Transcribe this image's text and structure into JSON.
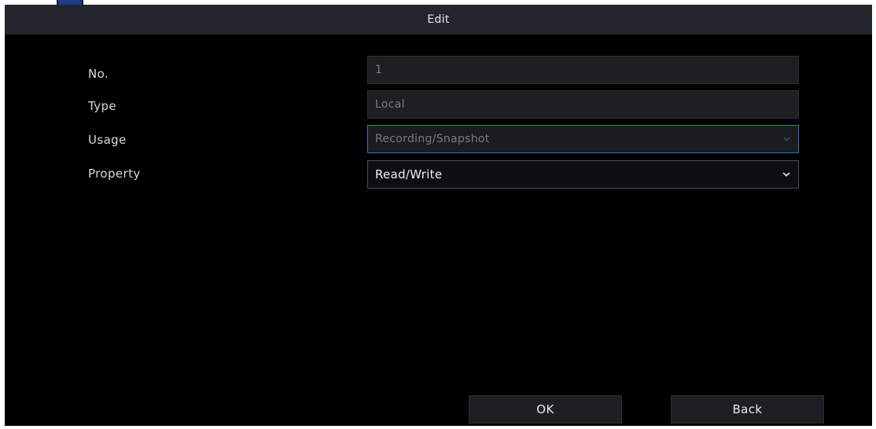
{
  "dialog": {
    "title": "Edit"
  },
  "form": {
    "no": {
      "label": "No.",
      "value": "1"
    },
    "type": {
      "label": "Type",
      "value": "Local"
    },
    "usage": {
      "label": "Usage",
      "value": "Recording/Snapshot"
    },
    "property": {
      "label": "Property",
      "value": "Read/Write"
    }
  },
  "buttons": {
    "ok": "OK",
    "back": "Back"
  },
  "colors": {
    "background": "#000000",
    "titlebar": "#23262c",
    "focus_border": "#3d6fd1",
    "text": "#d9d9d9",
    "disabled_text": "#7a7c80"
  },
  "icons": {
    "usage_dropdown": "chevron-down-icon",
    "property_dropdown": "chevron-down-icon"
  }
}
